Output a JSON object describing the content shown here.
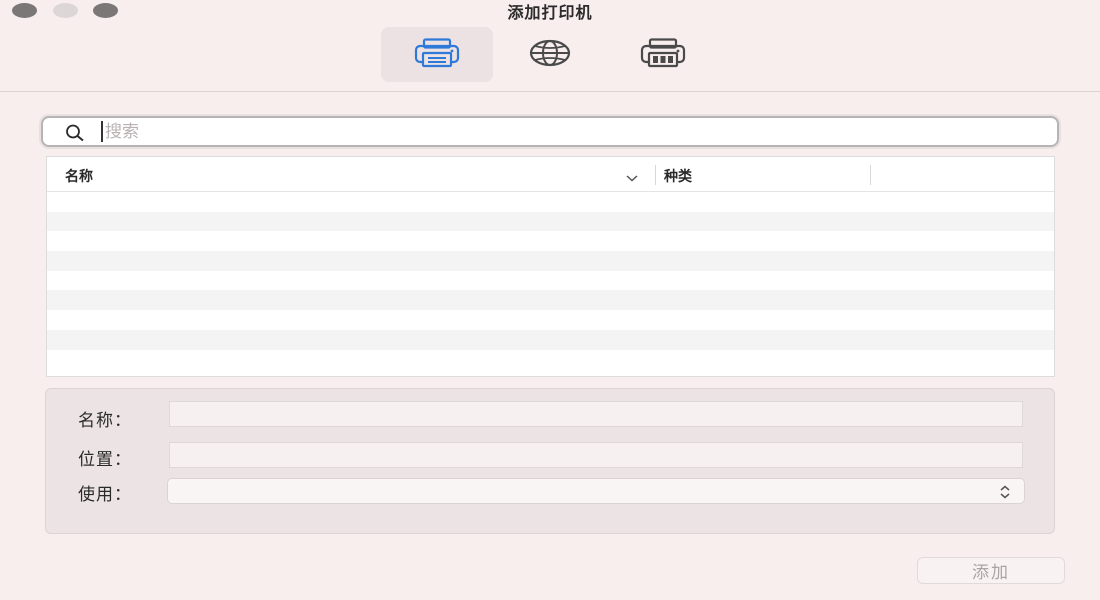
{
  "window": {
    "title": "添加打印机"
  },
  "toolbar": {
    "items": [
      {
        "icon": "default-printer-icon",
        "active": true
      },
      {
        "icon": "ip-globe-icon",
        "active": false
      },
      {
        "icon": "windows-printer-icon",
        "active": false
      }
    ]
  },
  "search": {
    "placeholder": "搜索",
    "value": ""
  },
  "table": {
    "columns": [
      "名称",
      "种类"
    ],
    "rows": []
  },
  "details": {
    "name_label": "名称：",
    "location_label": "位置：",
    "use_label": "使用：",
    "name_value": "",
    "location_value": "",
    "use_value": ""
  },
  "actions": {
    "add_label": "添加"
  },
  "colors": {
    "accent": "#2f7ad9",
    "background": "#f8eeee",
    "icon_gray": "#4a4a4a"
  }
}
